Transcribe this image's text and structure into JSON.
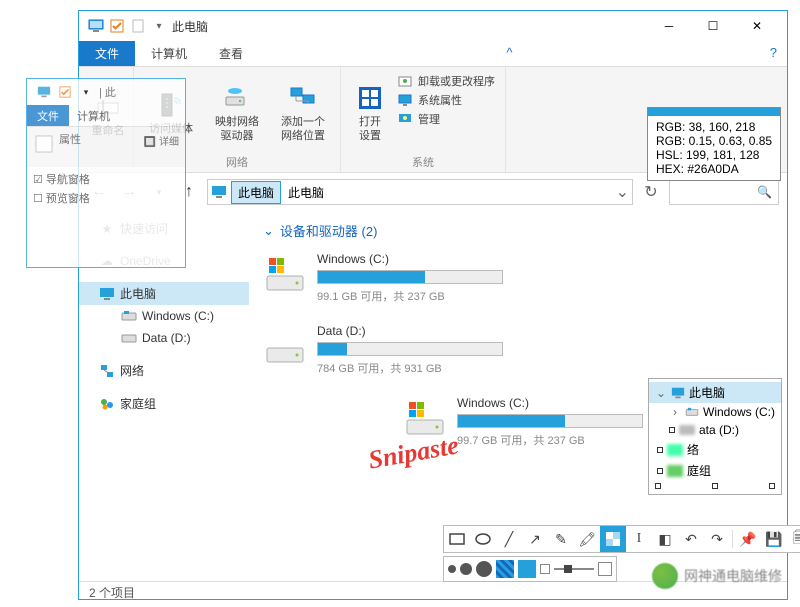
{
  "title": "此电脑",
  "tabs": {
    "file": "文件",
    "computer": "计算机",
    "view": "查看"
  },
  "ribbon": {
    "rename": "重命名",
    "access_media": "访问媒体",
    "map_drive": "映射网络\n驱动器",
    "add_network": "添加一个\n网络位置",
    "network_group": "网络",
    "open_settings": "打开\n设置",
    "uninstall": "卸载或更改程序",
    "sys_props": "系统属性",
    "manage": "管理",
    "system_group": "系统"
  },
  "addr": {
    "thispc": "此电脑",
    "breadcrumb": "此电脑"
  },
  "nav": {
    "quick": "快速访问",
    "onedrive": "OneDrive",
    "thispc": "此电脑",
    "win_c": "Windows (C:)",
    "data_d": "Data (D:)",
    "network": "网络",
    "homegroup": "家庭组",
    "nav_pane": "导航窗格",
    "preview_pane": "预览窗格",
    "details": "详细"
  },
  "section": {
    "devices": "设备和驱动器 (2)"
  },
  "drives": {
    "c1": {
      "name": "Windows (C:)",
      "info": "99.1 GB 可用，共 237 GB",
      "pct": 58
    },
    "d1": {
      "name": "Data (D:)",
      "info": "784 GB 可用，共 931 GB",
      "pct": 16
    },
    "c2": {
      "name": "Windows (C:)",
      "info": "99.7 GB 可用，共 237 GB",
      "pct": 58
    }
  },
  "status": "2 个项目",
  "colorinfo": {
    "rgb": "RGB:  38, 160, 218",
    "rgbn": "RGB: 0.15, 0.63, 0.85",
    "hsl": "HSL: 199, 181, 128",
    "hex": "HEX:    #26A0DA"
  },
  "tree": {
    "root": "此电脑",
    "winc": "Windows (C:)",
    "datad": "ata (D:)",
    "net": "络",
    "hg": "庭组"
  },
  "watermark": "Snipaste",
  "footer": "网神通电脑维修"
}
